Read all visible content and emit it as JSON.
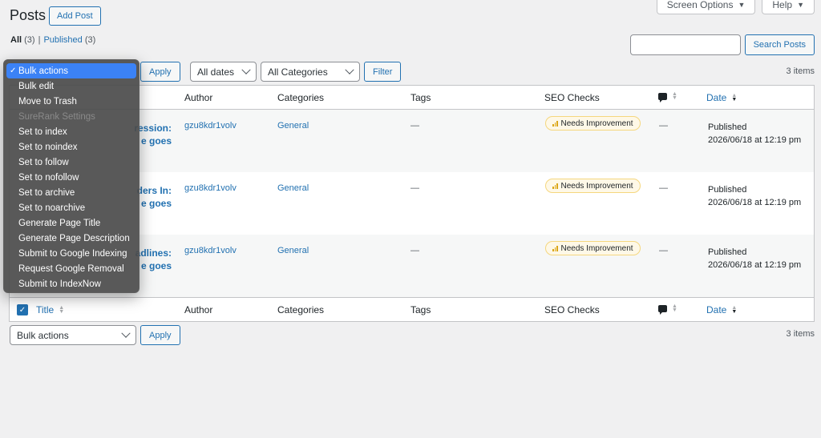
{
  "header": {
    "screen_options": "Screen Options",
    "help": "Help",
    "title": "Posts",
    "add_post": "Add Post"
  },
  "filters": {
    "all_label": "All",
    "all_count": "(3)",
    "separator": "|",
    "published_label": "Published",
    "published_count": "(3)"
  },
  "search": {
    "value": "",
    "button": "Search Posts"
  },
  "toolbar": {
    "apply": "Apply",
    "dates": "All dates",
    "categories": "All Categories",
    "filter": "Filter",
    "items": "3 items"
  },
  "bulk_menu": {
    "items": [
      "Bulk actions",
      "Bulk edit",
      "Move to Trash",
      "SureRank Settings",
      "Set to index",
      "Set to noindex",
      "Set to follow",
      "Set to nofollow",
      "Set to archive",
      "Set to noarchive",
      "Generate Page Title",
      "Generate Page Description",
      "Submit to Google Indexing",
      "Request Google Removal",
      "Submit to IndexNow"
    ],
    "check": "✓"
  },
  "columns": {
    "title": "Title",
    "author": "Author",
    "categories": "Categories",
    "tags": "Tags",
    "seo": "SEO Checks",
    "date": "Date"
  },
  "rows": [
    {
      "title_l1": "ression:",
      "title_l2": "e goes",
      "author": "gzu8kdr1volv",
      "category": "General",
      "tags": "—",
      "seo": "Needs Improvement",
      "comments": "—",
      "status": "Published",
      "date": "2026/06/18 at 12:19 pm"
    },
    {
      "title_l1": "ders In:",
      "title_l2": "e goes",
      "author": "gzu8kdr1volv",
      "category": "General",
      "tags": "—",
      "seo": "Needs Improvement",
      "comments": "—",
      "status": "Published",
      "date": "2026/06/18 at 12:19 pm"
    },
    {
      "title_l1": "adlines:",
      "title_l2": "e goes",
      "author": "gzu8kdr1volv",
      "category": "General",
      "tags": "—",
      "seo": "Needs Improvement",
      "comments": "—",
      "status": "Published",
      "date": "2026/06/18 at 12:19 pm"
    }
  ],
  "bottom": {
    "bulk": "Bulk actions",
    "apply": "Apply",
    "items": "3 items"
  },
  "colors": {
    "accent": "#2271b1",
    "highlight": "#3b82f6",
    "badge_bg": "#fef8e7"
  }
}
